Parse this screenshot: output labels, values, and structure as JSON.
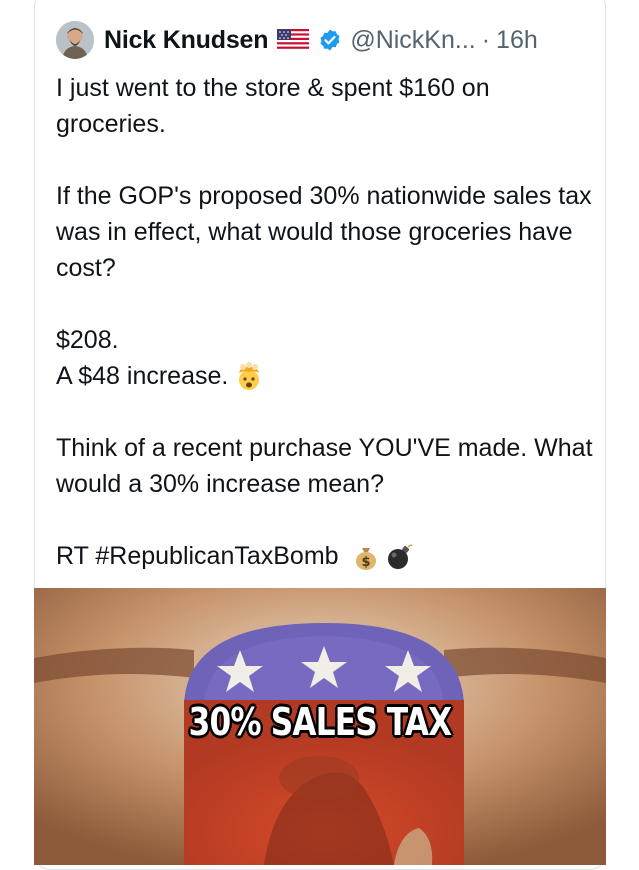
{
  "tweet": {
    "author_name": "Nick Knudsen",
    "handle": "@NickKn...",
    "separator": "·",
    "time": "16h",
    "paragraphs": [
      "I just went to the store & spent $160 on groceries.",
      "If the GOP's proposed 30% nationwide sales tax was in effect, what would those groceries have cost?",
      "$208.\nA $48 increase.",
      "Think of a recent purchase YOU'VE made. What would a 30% increase mean?",
      "RT #RepublicanTaxBomb"
    ]
  },
  "media": {
    "caption_text": "30% SALES TAX"
  },
  "icons": {
    "flag": "us-flag-icon",
    "verified": "verified-badge-icon",
    "mind_blown": "exploding-head-emoji",
    "money_bag": "money-bag-emoji",
    "bomb": "bomb-emoji"
  },
  "colors": {
    "text": "#0f1419",
    "secondary_text": "#536471",
    "verified_blue": "#1d9bf0",
    "border": "#dfe3e7"
  }
}
